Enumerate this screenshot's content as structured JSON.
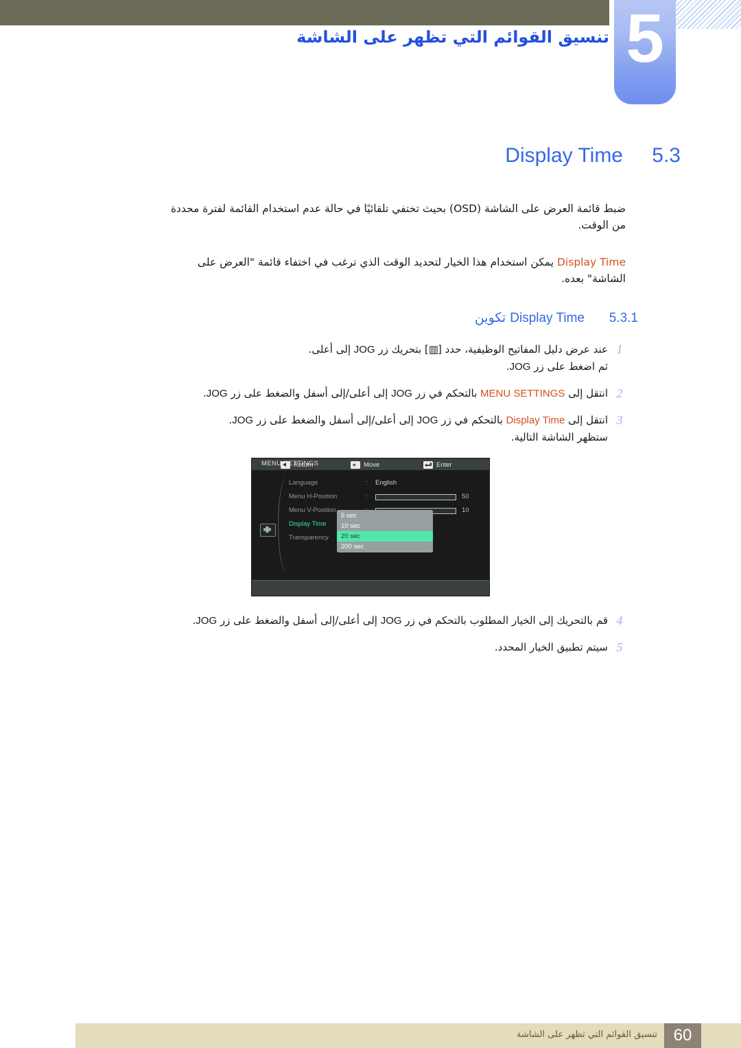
{
  "header": {
    "chapter_number": "5",
    "chapter_title": "تنسيق القوائم التي تظهر على الشاشة"
  },
  "section": {
    "number": "5.3",
    "name": "Display Time"
  },
  "paragraphs": {
    "intro": "ضبط قائمة العرض على الشاشة (OSD) بحيث تختفي تلقائيًا في حالة عدم استخدام القائمة لفترة محددة من الوقت.",
    "detail_prefix": "يمكن استخدام هذا الخيار لتحديد الوقت الذي ترغب في اختفاء قائمة \"العرض على الشاشة\" بعده.",
    "detail_keyword": "Display Time"
  },
  "subsection": {
    "number": "5.3.1",
    "label_ar": "تكوين",
    "label_en": "Display Time"
  },
  "steps": [
    {
      "num": "1",
      "line1_a": "عند عرض دليل المفاتيح الوظيفية، حدد [",
      "glyph": "▥",
      "line1_b": "] بتحريك زر",
      "kw": "JOG",
      "line1_c": "إلى أعلى.",
      "line2_a": "ثم اضغط على زر",
      "line2_kw": "JOG",
      "line2_b": "."
    },
    {
      "num": "2",
      "text_a": "انتقل إلى",
      "kw_orange": "MENU SETTINGS",
      "text_b": "بالتحكم في زر",
      "kw1": "JOG",
      "text_c": "إلى أعلى/إلى أسفل والضغط على زر",
      "kw2": "JOG",
      "text_d": "."
    },
    {
      "num": "3",
      "text_a": "انتقل إلى",
      "kw_orange": "Display Time",
      "text_b": "بالتحكم في زر",
      "kw1": "JOG",
      "text_c": "إلى أعلى/إلى أسفل والضغط على زر",
      "kw2": "JOG",
      "text_d": ".",
      "line2": "ستظهر الشاشة التالية."
    },
    {
      "num": "4",
      "text_a": "قم بالتحريك إلى الخيار المطلوب بالتحكم في زر",
      "kw1": "JOG",
      "text_c": "إلى أعلى/إلى أسفل والضغط على زر",
      "kw2": "JOG",
      "text_d": "."
    },
    {
      "num": "5",
      "text_a": "سيتم تطبيق الخيار المحدد."
    }
  ],
  "osd": {
    "title": "MENU SETTINGS",
    "rows": [
      {
        "label": "Language",
        "colon": ":",
        "value": "English",
        "kind": "text"
      },
      {
        "label": "Menu H-Position",
        "colon": ":",
        "kind": "slider",
        "percent": 50,
        "number": "50"
      },
      {
        "label": "Menu V-Position",
        "colon": ":",
        "kind": "slider",
        "percent": 10,
        "number": "10"
      },
      {
        "label": "Display Time",
        "colon": ":",
        "kind": "dropdown",
        "active": true
      },
      {
        "label": "Transparency",
        "colon": ":",
        "kind": "text",
        "value": ""
      }
    ],
    "dropdown_options": [
      {
        "label": "5 sec",
        "selected": false
      },
      {
        "label": "10 sec",
        "selected": false
      },
      {
        "label": "20 sec",
        "selected": true
      },
      {
        "label": "200 sec",
        "selected": false
      }
    ],
    "footer": [
      {
        "icon": "left-arrow-key-icon",
        "label": "Return"
      },
      {
        "icon": "move-key-icon",
        "label": "Move"
      },
      {
        "icon": "enter-key-icon",
        "label": "Enter"
      }
    ]
  },
  "footer": {
    "text": "تنسيق القوائم التي تظهر على الشاشة",
    "page_number": "60"
  },
  "colors": {
    "accent_blue": "#3568e8",
    "keyword_orange": "#d1511d",
    "olive_bar": "#6b6b57",
    "footer_band": "#e4dcba",
    "page_badge": "#8d8275",
    "osd_highlight_green": "#4fe9ab"
  }
}
